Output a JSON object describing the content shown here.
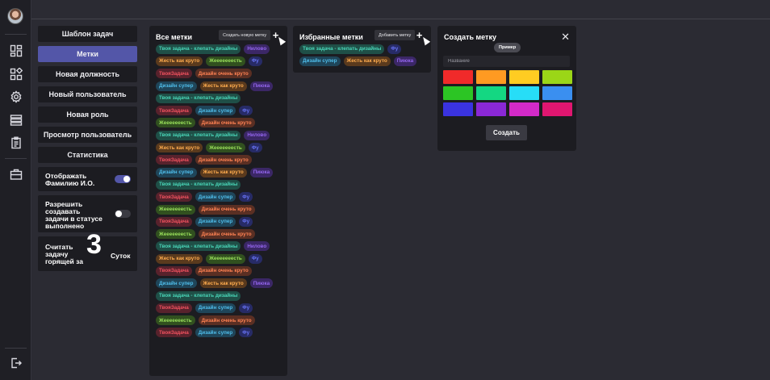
{
  "menu": [
    {
      "label": "Шаблон задач",
      "active": false
    },
    {
      "label": "Метки",
      "active": true
    },
    {
      "label": "Новая должность",
      "active": false
    },
    {
      "label": "Новый пользователь",
      "active": false
    },
    {
      "label": "Новая роль",
      "active": false
    },
    {
      "label": "Просмотр пользователь",
      "active": false
    },
    {
      "label": "Статистика",
      "active": false
    }
  ],
  "options": {
    "show_fio": {
      "label_1": "Отображать",
      "label_2": "Фамилию И.О.",
      "on": true
    },
    "allow_create": {
      "label_1": "Разрешить",
      "label_2": "создавать",
      "label_3": "задачи в статусе",
      "label_4": "выполнено",
      "on": false
    },
    "burning": {
      "label_1": "Считать",
      "label_2": "задачу",
      "label_3": "горящей за",
      "value": "3",
      "unit": "Суток"
    }
  },
  "all_tags": {
    "title": "Все метки",
    "create_btn": "Создать новую метку",
    "rows": [
      [
        {
          "t": "Твоя задача - клепать дизайны",
          "c": "teal"
        },
        {
          "t": "Нилово",
          "c": "purple"
        }
      ],
      [
        {
          "t": "Жесть как круто",
          "c": "orange"
        },
        {
          "t": "Жееееееесть",
          "c": "green"
        },
        {
          "t": "Фу",
          "c": "blue"
        }
      ],
      [
        {
          "t": "ТвояЗадача",
          "c": "red"
        },
        {
          "t": "Дизайн очень круто",
          "c": "brown"
        }
      ],
      [
        {
          "t": "Дизайн супер",
          "c": "cyan"
        },
        {
          "t": "Жесть как круто",
          "c": "orange"
        },
        {
          "t": "Пиюка",
          "c": "purple"
        }
      ],
      [
        {
          "t": "Твоя задача - клепать дизайны",
          "c": "teal"
        }
      ],
      [
        {
          "t": "ТвояЗадача",
          "c": "red"
        },
        {
          "t": "Дизайн супер",
          "c": "cyan"
        },
        {
          "t": "Фу",
          "c": "blue"
        }
      ],
      [
        {
          "t": "Жееееееесть",
          "c": "green"
        },
        {
          "t": "Дизайн очень круто",
          "c": "brown"
        }
      ],
      [
        {
          "t": "Твоя задача - клепать дизайны",
          "c": "teal"
        },
        {
          "t": "Нилово",
          "c": "purple"
        }
      ],
      [
        {
          "t": "Жесть как круто",
          "c": "orange"
        },
        {
          "t": "Жееееееесть",
          "c": "green"
        },
        {
          "t": "Фу",
          "c": "blue"
        }
      ],
      [
        {
          "t": "ТвояЗадача",
          "c": "red"
        },
        {
          "t": "Дизайн очень круто",
          "c": "brown"
        }
      ],
      [
        {
          "t": "Дизайн супер",
          "c": "cyan"
        },
        {
          "t": "Жесть как круто",
          "c": "orange"
        },
        {
          "t": "Пиюка",
          "c": "purple"
        }
      ],
      [
        {
          "t": "Твоя задача - клепать дизайны",
          "c": "teal"
        }
      ],
      [
        {
          "t": "ТвояЗадача",
          "c": "red"
        },
        {
          "t": "Дизайн супер",
          "c": "cyan"
        },
        {
          "t": "Фу",
          "c": "blue"
        }
      ],
      [
        {
          "t": "Жееееееесть",
          "c": "green"
        },
        {
          "t": "Дизайн очень круто",
          "c": "brown"
        }
      ],
      [
        {
          "t": "ТвояЗадача",
          "c": "red"
        },
        {
          "t": "Дизайн супер",
          "c": "cyan"
        },
        {
          "t": "Фу",
          "c": "blue"
        }
      ],
      [
        {
          "t": "Жееееееесть",
          "c": "green"
        },
        {
          "t": "Дизайн очень круто",
          "c": "brown"
        }
      ],
      [
        {
          "t": "Твоя задача - клепать дизайны",
          "c": "teal"
        },
        {
          "t": "Нилово",
          "c": "purple"
        }
      ],
      [
        {
          "t": "Жесть как круто",
          "c": "orange"
        },
        {
          "t": "Жееееееесть",
          "c": "green"
        },
        {
          "t": "Фу",
          "c": "blue"
        }
      ],
      [
        {
          "t": "ТвояЗадача",
          "c": "red"
        },
        {
          "t": "Дизайн очень круто",
          "c": "brown"
        }
      ],
      [
        {
          "t": "Дизайн супер",
          "c": "cyan"
        },
        {
          "t": "Жесть как круто",
          "c": "orange"
        },
        {
          "t": "Пиюка",
          "c": "purple"
        }
      ],
      [
        {
          "t": "Твоя задача - клепать дизайны",
          "c": "teal"
        }
      ],
      [
        {
          "t": "ТвояЗадача",
          "c": "red"
        },
        {
          "t": "Дизайн супер",
          "c": "cyan"
        },
        {
          "t": "Фу",
          "c": "blue"
        }
      ],
      [
        {
          "t": "Жееееееесть",
          "c": "green"
        },
        {
          "t": "Дизайн очень круто",
          "c": "brown"
        }
      ],
      [
        {
          "t": "ТвояЗадача",
          "c": "red"
        },
        {
          "t": "Дизайн супер",
          "c": "cyan"
        },
        {
          "t": "Фу",
          "c": "blue"
        }
      ]
    ]
  },
  "fav_tags": {
    "title": "Избранные метки",
    "add_btn": "Добавить метку",
    "rows": [
      [
        {
          "t": "Твоя задача - клепать дизайны",
          "c": "teal"
        },
        {
          "t": "Фу",
          "c": "blue"
        }
      ],
      [
        {
          "t": "Дизайн супер",
          "c": "cyan"
        },
        {
          "t": "Жесть как круто",
          "c": "orange"
        },
        {
          "t": "Пиюка",
          "c": "purple"
        }
      ]
    ]
  },
  "create_tag": {
    "title": "Создать метку",
    "preview": "Пример",
    "name_placeholder": "Название",
    "submit": "Создать",
    "colors": [
      "#f02a2a",
      "#ff9a22",
      "#ffcc22",
      "#9bd617",
      "#2cc524",
      "#14d782",
      "#27ddf7",
      "#3a8ff0",
      "#3a33e0",
      "#8a28d6",
      "#d32ac8",
      "#e01670"
    ]
  },
  "tag_colors": {
    "teal": {
      "bg": "#1f4f47",
      "fg": "#49d6b8"
    },
    "purple": {
      "bg": "#3b2766",
      "fg": "#9466ee"
    },
    "orange": {
      "bg": "#5a3a1d",
      "fg": "#ffad4f"
    },
    "green": {
      "bg": "#31501f",
      "fg": "#99e05b"
    },
    "blue": {
      "bg": "#272b66",
      "fg": "#6873f4"
    },
    "red": {
      "bg": "#58222c",
      "fg": "#f0525f"
    },
    "brown": {
      "bg": "#5a2f23",
      "fg": "#ff8253"
    },
    "cyan": {
      "bg": "#1f4559",
      "fg": "#4fbdea"
    }
  }
}
